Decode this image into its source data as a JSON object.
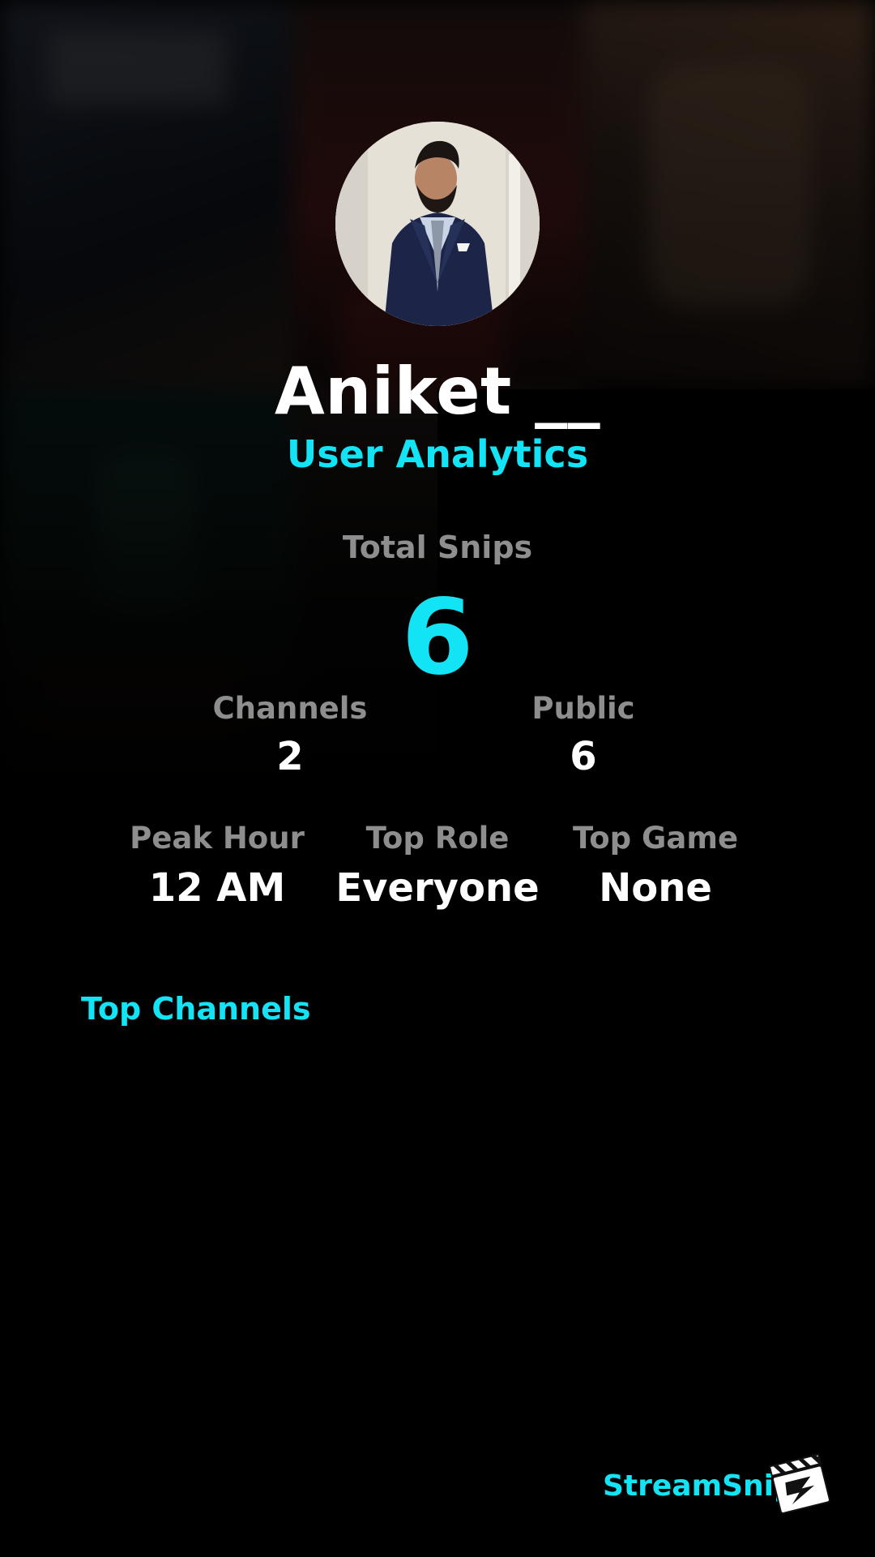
{
  "profile": {
    "name": "Aniket __",
    "subtitle": "User Analytics"
  },
  "stats": {
    "total_snips_label": "Total Snips",
    "total_snips_value": "6",
    "channels_label": "Channels",
    "channels_value": "2",
    "public_label": "Public",
    "public_value": "6",
    "peak_hour_label": "Peak Hour",
    "peak_hour_value": "12 AM",
    "top_role_label": "Top Role",
    "top_role_value": "Everyone",
    "top_game_label": "Top Game",
    "top_game_value": "None"
  },
  "sections": {
    "top_channels_title": "Top Channels"
  },
  "brand": {
    "name": "StreamSnip",
    "logo_icon": "clapperboard-icon"
  },
  "colors": {
    "accent": "#12e4f6",
    "label": "#8e8e8e",
    "text": "#ffffff",
    "background": "#000000"
  }
}
